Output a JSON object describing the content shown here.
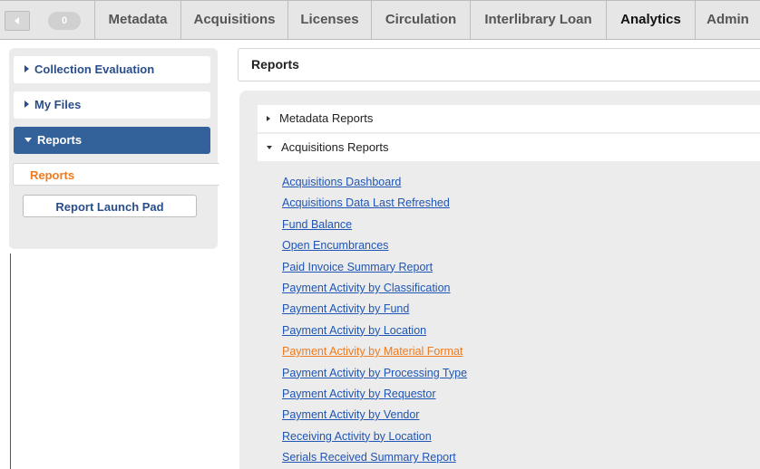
{
  "topbar": {
    "badge_count": "0",
    "tabs": [
      {
        "label": "Metadata",
        "active": false
      },
      {
        "label": "Acquisitions",
        "active": false
      },
      {
        "label": "Licenses",
        "active": false
      },
      {
        "label": "Circulation",
        "active": false
      },
      {
        "label": "Interlibrary Loan",
        "active": false
      },
      {
        "label": "Analytics",
        "active": true
      },
      {
        "label": "Admin",
        "active": false
      }
    ]
  },
  "sidebar": {
    "items": [
      {
        "label": "Collection Evaluation",
        "icon": "chevron-right-icon"
      },
      {
        "label": "My Files",
        "icon": "chevron-right-icon"
      },
      {
        "label": "Reports",
        "icon": "chevron-down-icon",
        "selected": true
      }
    ],
    "sub_items": [
      {
        "label": "Reports",
        "current": true
      },
      {
        "label": "Report Launch Pad",
        "current": false
      }
    ]
  },
  "main": {
    "page_title": "Reports",
    "sections": [
      {
        "label": "Metadata Reports",
        "expanded": false
      },
      {
        "label": "Acquisitions Reports",
        "expanded": true
      }
    ],
    "acquisitions_reports": [
      "Acquisitions Dashboard",
      "Acquisitions Data Last Refreshed",
      "Fund Balance",
      "Open Encumbrances",
      "Paid Invoice Summary Report",
      "Payment Activity by Classification",
      "Payment Activity by Fund",
      "Payment Activity by Location",
      "Payment Activity by Material Format",
      "Payment Activity by Processing Type",
      "Payment Activity by Requestor",
      "Payment Activity by Vendor",
      "Receiving Activity by Location",
      "Serials Received Summary Report"
    ],
    "hovered_report": "Payment Activity by Material Format"
  },
  "colors": {
    "link": "#1f55b4",
    "link_hover": "#f07a1e",
    "selected_nav": "#33629b",
    "nav_text": "#2a4d8c"
  }
}
